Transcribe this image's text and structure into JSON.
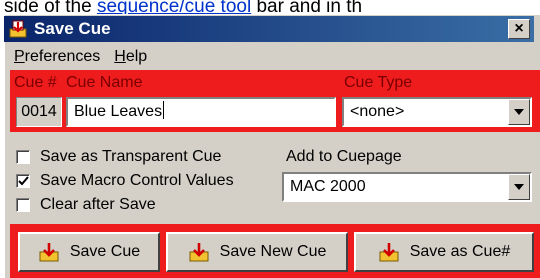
{
  "doc": {
    "prefix": "side of the ",
    "link": "sequence/cue tool",
    "suffix": " bar and in th"
  },
  "window": {
    "title": "Save Cue",
    "close_label": "×"
  },
  "menu": [
    {
      "ul": "P",
      "rest": "references"
    },
    {
      "ul": "H",
      "rest": "elp"
    }
  ],
  "cue": {
    "num_header": "Cue #",
    "name_header": "Cue Name",
    "type_header": "Cue Type",
    "number": "0014",
    "name": "Blue Leaves",
    "type": "<none>"
  },
  "options": {
    "transparent": {
      "label": "Save as Transparent Cue",
      "checked": false
    },
    "macro": {
      "label": "Save Macro Control Values",
      "checked": true
    },
    "clear": {
      "label": "Clear after Save",
      "checked": false
    }
  },
  "cuepage": {
    "label": "Add to Cuepage",
    "value": "MAC 2000"
  },
  "buttons": {
    "save": "Save Cue",
    "save_new": "Save New Cue",
    "save_as": "Save as Cue#"
  },
  "colors": {
    "accent_red": "#ee1c1c",
    "title_start": "#0a246a",
    "title_end": "#3a6ea5"
  },
  "icons": {
    "app": "save-cue-icon",
    "buttons": "save-arrow-icon"
  }
}
